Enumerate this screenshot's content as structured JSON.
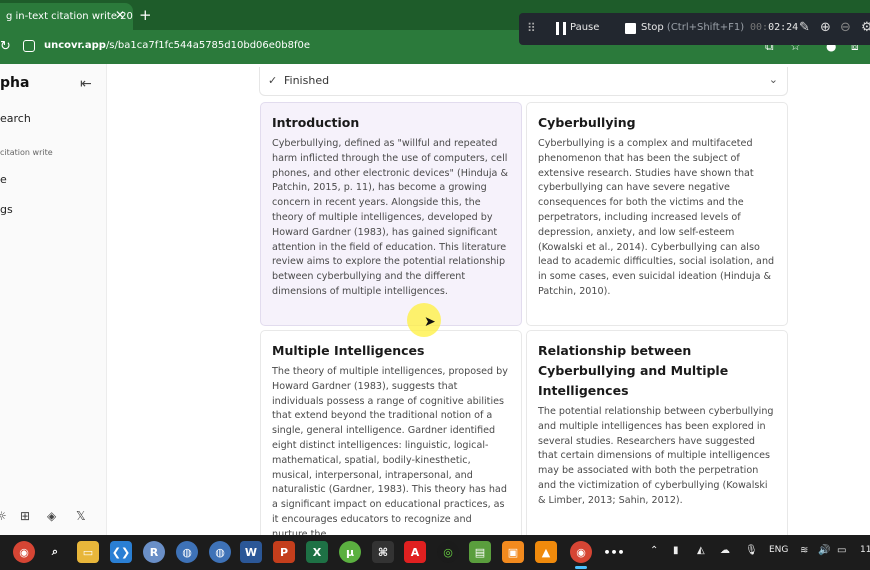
{
  "browser": {
    "tab_title": "g in-text citation write 200",
    "tab_close": "✕",
    "new_tab": "+",
    "url_host": "uncovr.app",
    "url_path": "/s/ba1ca7f1fc544a5785d10bd06e0b8f0e"
  },
  "recorder": {
    "pause_label": "Pause",
    "stop_label": "Stop",
    "stop_shortcut": "(Ctrl+Shift+F1)",
    "timer_prefix": "00:",
    "timer": "02:24"
  },
  "sidebar": {
    "brand": "pha",
    "items": [
      {
        "label": "earch"
      },
      {
        "label": "citation write"
      },
      {
        "label": "e"
      },
      {
        "label": "gs"
      }
    ]
  },
  "main": {
    "status": "Finished",
    "cards": [
      {
        "title": "Introduction",
        "body": "Cyberbullying, defined as \"willful and repeated harm inflicted through the use of computers, cell phones, and other electronic devices\" (Hinduja & Patchin, 2015, p. 11), has become a growing concern in recent years. Alongside this, the theory of multiple intelligences, developed by Howard Gardner (1983), has gained significant attention in the field of education. This literature review aims to explore the potential relationship between cyberbullying and the different dimensions of multiple intelligences."
      },
      {
        "title": "Cyberbullying",
        "body": "Cyberbullying is a complex and multifaceted phenomenon that has been the subject of extensive research. Studies have shown that cyberbullying can have severe negative consequences for both the victims and the perpetrators, including increased levels of depression, anxiety, and low self-esteem (Kowalski et al., 2014). Cyberbullying can also lead to academic difficulties, social isolation, and in some cases, even suicidal ideation (Hinduja & Patchin, 2010)."
      },
      {
        "title": "Multiple Intelligences",
        "body": "The theory of multiple intelligences, proposed by Howard Gardner (1983), suggests that individuals possess a range of cognitive abilities that extend beyond the traditional notion of a single, general intelligence. Gardner identified eight distinct intelligences: linguistic, logical-mathematical, spatial, bodily-kinesthetic, musical, interpersonal, intrapersonal, and naturalistic (Gardner, 1983). This theory has had a significant impact on educational practices, as it encourages educators to recognize and nurture the"
      },
      {
        "title": "Relationship between Cyberbullying and Multiple Intelligences",
        "body": "The potential relationship between cyberbullying and multiple intelligences has been explored in several studies. Researchers have suggested that certain dimensions of multiple intelligences may be associated with both the perpetration and the victimization of cyberbullying (Kowalski & Limber, 2013; Sahin, 2012)."
      }
    ]
  },
  "taskbar": {
    "language": "ENG",
    "clock": "11"
  },
  "colors": {
    "chrome_green": "#2b7a3b",
    "tabbar_green": "#1e5c2a",
    "active_card": "#f6f2fb",
    "cursor_highlight": "#fff03c"
  }
}
